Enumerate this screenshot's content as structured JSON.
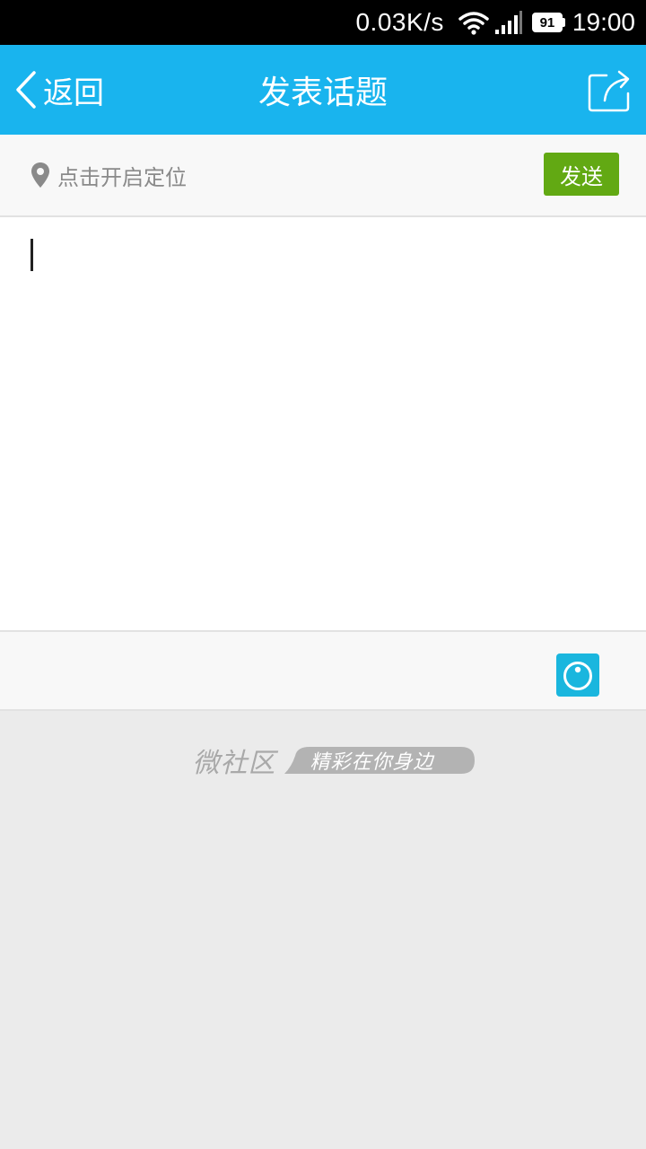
{
  "status_bar": {
    "net_speed": "0.03K/s",
    "battery_level": "91",
    "time": "19:00",
    "icons": [
      "wifi-icon",
      "signal-icon",
      "battery-icon"
    ]
  },
  "header": {
    "back_label": "返回",
    "title": "发表话题",
    "share_icon": "share-icon",
    "background_color": "#19b4ee"
  },
  "location_row": {
    "label": "点击开启定位",
    "icon": "map-pin-icon",
    "send_label": "发送",
    "send_color": "#62a913"
  },
  "editor": {
    "value": "",
    "placeholder": ""
  },
  "toolbar": {
    "camera_icon": "camera-icon",
    "camera_color": "#1ab6de"
  },
  "branding": {
    "name": "微社区",
    "slogan": "精彩在你身边"
  }
}
